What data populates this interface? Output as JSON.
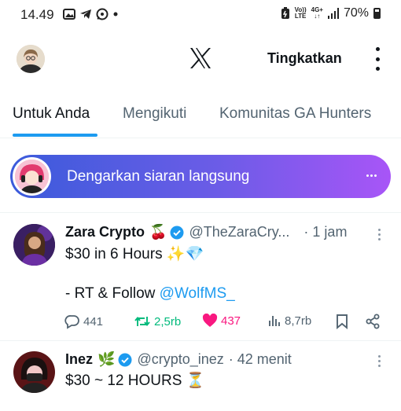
{
  "status_bar": {
    "time": "14.49",
    "volte_top": "Vo))",
    "volte_bottom": "LTE",
    "net_top": "4G+",
    "net_bottom": "↓↑",
    "battery": "70%"
  },
  "header": {
    "upgrade_label": "Tingkatkan"
  },
  "tabs": [
    {
      "label": "Untuk Anda"
    },
    {
      "label": "Mengikuti"
    },
    {
      "label": "Komunitas GA Hunters"
    }
  ],
  "live": {
    "label": "Dengarkan siaran langsung"
  },
  "tweets": [
    {
      "name": "Zara Crypto",
      "name_emoji": "🍒",
      "handle": "@TheZaraCry...",
      "time": "· 1 jam",
      "line1": "$30 in 6 Hours ✨💎",
      "line2_prefix": "- RT & Follow ",
      "line2_link": "@WolfMS_",
      "replies": "441",
      "retweets": "2,5rb",
      "likes": "437",
      "views": "8,7rb"
    },
    {
      "name": "Inez",
      "name_emoji": "🌿",
      "handle": "@crypto_inez",
      "time": "· 42 menit",
      "line1": "$30 ~ 12 HOURS ⏳"
    }
  ],
  "colors": {
    "accent": "#1d9bf0",
    "retweet": "#00ba7c",
    "like": "#f91880",
    "muted": "#536471"
  }
}
